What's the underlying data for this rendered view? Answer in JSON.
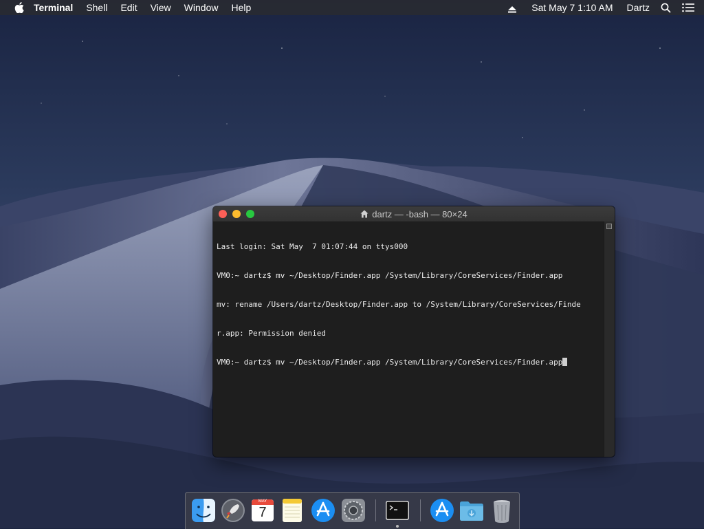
{
  "menubar": {
    "app_name": "Terminal",
    "menus": [
      "Shell",
      "Edit",
      "View",
      "Window",
      "Help"
    ],
    "clock": "Sat May 7  1:10 AM",
    "user": "Dartz"
  },
  "terminal": {
    "title": "dartz — -bash — 80×24",
    "lines": [
      "Last login: Sat May  7 01:07:44 on ttys000",
      "VM0:~ dartz$ mv ~/Desktop/Finder.app /System/Library/CoreServices/Finder.app",
      "mv: rename /Users/dartz/Desktop/Finder.app to /System/Library/CoreServices/Finde",
      "r.app: Permission denied",
      "VM0:~ dartz$ mv ~/Desktop/Finder.app /System/Library/CoreServices/Finder.app"
    ]
  },
  "dock": {
    "calendar_month": "MAY",
    "calendar_day": "7",
    "items": [
      "finder-icon",
      "launchpad-icon",
      "calendar-icon",
      "notes-icon",
      "app-store-icon",
      "system-preferences-icon",
      "terminal-icon",
      "app-store-downloads-icon",
      "downloads-folder-icon",
      "trash-icon"
    ]
  },
  "colors": {
    "close": "#fc5f57",
    "minimize": "#fdbc2e",
    "maximize": "#28c840",
    "terminal_bg": "#1e1e1e"
  }
}
